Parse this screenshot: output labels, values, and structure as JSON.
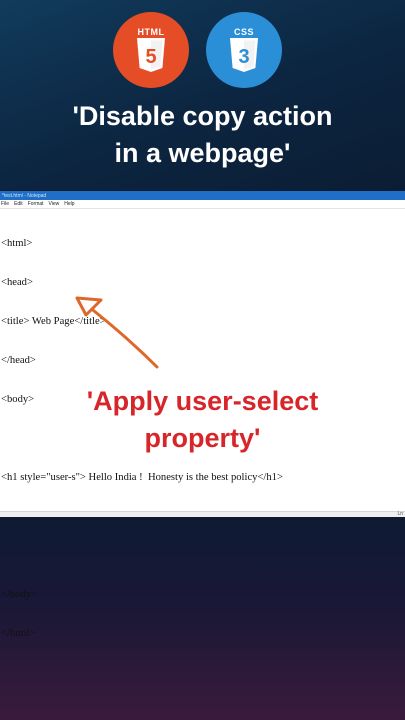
{
  "logos": {
    "html_label": "HTML",
    "html_number": "5",
    "css_label": "CSS",
    "css_number": "3"
  },
  "headline": {
    "line1": "'Disable copy action",
    "line2": "in a webpage'"
  },
  "notepad": {
    "title": "*test.html - Notepad",
    "menu": [
      "File",
      "Edit",
      "Format",
      "View",
      "Help"
    ],
    "lines": [
      "<html>",
      "<head>",
      "<title> Web Page</title>",
      "</head>",
      "<body>",
      "",
      "<h1 style=\"user-s\"> Hello India !  Honesty is the best policy</h1>",
      "",
      "",
      "</body>",
      "</html>"
    ],
    "status": "Ln"
  },
  "callout": {
    "line1": "'Apply user-select",
    "line2": "property'"
  },
  "colors": {
    "accent_red": "#d6262a",
    "html_orange": "#e44d26",
    "css_blue": "#2a8fd6",
    "arrow": "#e0672a"
  }
}
